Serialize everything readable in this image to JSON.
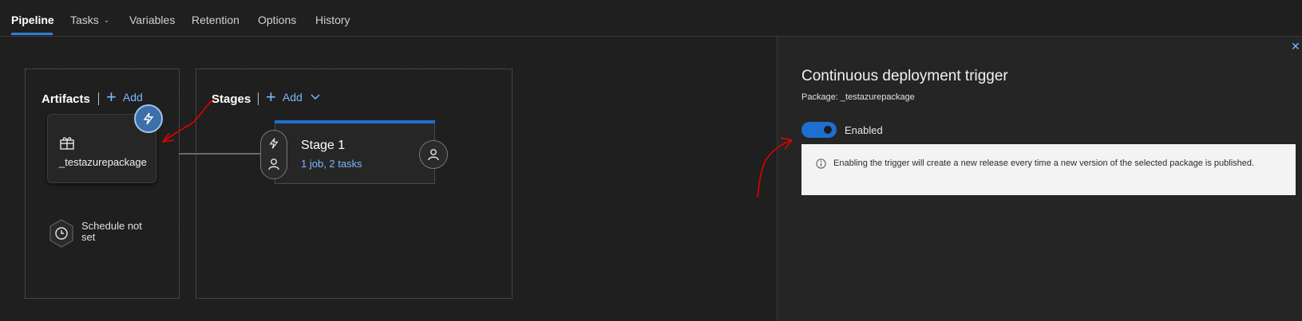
{
  "tabs": [
    {
      "label": "Pipeline"
    },
    {
      "label": "Tasks"
    },
    {
      "label": "Variables"
    },
    {
      "label": "Retention"
    },
    {
      "label": "Options"
    },
    {
      "label": "History"
    }
  ],
  "artifacts": {
    "heading": "Artifacts",
    "add_label": "Add",
    "item_name": "_testazurepackage",
    "schedule_label": "Schedule not set"
  },
  "stages": {
    "heading": "Stages",
    "add_label": "Add",
    "stage_title": "Stage 1",
    "stage_summary": "1 job, 2 tasks"
  },
  "panel": {
    "title": "Continuous deployment trigger",
    "subtitle": "Package: _testazurepackage",
    "toggle_label": "Enabled",
    "toggle_on": true,
    "info_text": "Enabling the trigger will create a new release every time a new version of the selected package is published."
  },
  "colors": {
    "accent": "#1f6fd0",
    "link": "#7cb7ff",
    "annotation": "#e00000"
  },
  "icons": [
    "chevron-down-icon",
    "plus-icon",
    "package-icon",
    "lightning-icon",
    "person-icon",
    "clock-icon",
    "info-icon",
    "close-icon"
  ]
}
